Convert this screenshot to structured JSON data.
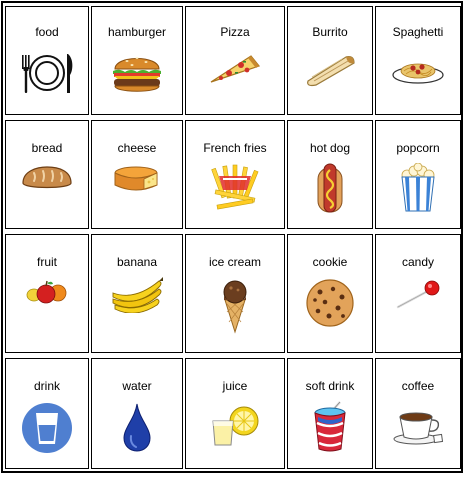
{
  "rows": [
    [
      {
        "id": "food",
        "label": "food",
        "icon": "plate-fork-knife-icon"
      },
      {
        "id": "hamburger",
        "label": "hamburger",
        "icon": "hamburger-icon"
      },
      {
        "id": "pizza",
        "label": "Pizza",
        "icon": "pizza-slice-icon"
      },
      {
        "id": "burrito",
        "label": "Burrito",
        "icon": "burrito-icon"
      },
      {
        "id": "spaghetti",
        "label": "Spaghetti",
        "icon": "spaghetti-plate-icon"
      }
    ],
    [
      {
        "id": "bread",
        "label": "bread",
        "icon": "bread-loaf-icon"
      },
      {
        "id": "cheese",
        "label": "cheese",
        "icon": "cheese-wheel-icon"
      },
      {
        "id": "french-fries",
        "label": "French fries",
        "icon": "french-fries-icon"
      },
      {
        "id": "hot-dog",
        "label": "hot dog",
        "icon": "hot-dog-icon"
      },
      {
        "id": "popcorn",
        "label": "popcorn",
        "icon": "popcorn-box-icon"
      }
    ],
    [
      {
        "id": "fruit",
        "label": "fruit",
        "icon": "fruit-icon"
      },
      {
        "id": "banana",
        "label": "banana",
        "icon": "banana-bunch-icon"
      },
      {
        "id": "ice-cream",
        "label": "ice cream",
        "icon": "ice-cream-cone-icon"
      },
      {
        "id": "cookie",
        "label": "cookie",
        "icon": "cookie-icon"
      },
      {
        "id": "candy",
        "label": "candy",
        "icon": "lollipop-icon"
      }
    ],
    [
      {
        "id": "drink",
        "label": "drink",
        "icon": "water-glass-icon"
      },
      {
        "id": "water",
        "label": "water",
        "icon": "water-drop-icon"
      },
      {
        "id": "juice",
        "label": "juice",
        "icon": "lemon-juice-icon"
      },
      {
        "id": "soft-drink",
        "label": "soft drink",
        "icon": "soda-cup-icon"
      },
      {
        "id": "coffee",
        "label": "coffee",
        "icon": "coffee-cup-icon"
      }
    ]
  ]
}
